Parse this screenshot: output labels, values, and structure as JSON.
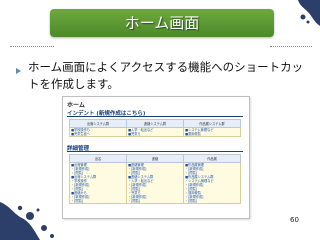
{
  "slide": {
    "title": "ホーム画面",
    "description": "ホーム画面によくアクセスする機能へのショートカットを作成します。",
    "page_number": "60"
  },
  "screenshot": {
    "heading": "ホーム",
    "section1": {
      "title": "インデント (新規作成はこちら)",
      "columns": [
        "出席システム群",
        "連絡システム群",
        "作品展システム群"
      ],
      "col1": [
        "■学校操作も",
        "■児童生徒へ"
      ],
      "col2": [
        "■入学・転出など",
        "■児童ら"
      ],
      "col3": [
        "■システム管理など",
        "■運用便覧"
      ]
    },
    "section2": {
      "title": "詳細管理",
      "columns": [
        "出名",
        "連絡",
        "作品展"
      ],
      "col1": [
        "■出席管理",
        "・[新規作成]",
        "・[閲覧]",
        "■出席システム群",
        "・学校操作",
        "・[新規作成]",
        "・[閲覧]",
        "■連絡から",
        "・[新規作成]",
        "・[閲覧]"
      ],
      "col2": [
        "■連絡管理",
        "・[新規作成]",
        "・[閲覧]",
        "■連絡システム群",
        "・入学・転出など",
        "・[新規作成]",
        "・[閲覧]",
        "・児童ら",
        "・[新規作成]",
        "・[閲覧]"
      ],
      "col3": [
        "■作品展管理",
        "・[新規作成]",
        "・[閲覧]",
        "■作品展システム群",
        "・システム管理など",
        "・[新規作成]",
        "・[閲覧]",
        "・運用便覧",
        "・[新規作成]",
        "・[閲覧]"
      ]
    }
  },
  "colors": {
    "title_bar": "#5a9a35",
    "accent_blue": "#1a3f7a",
    "cell_yellow": "#fffbe0"
  }
}
